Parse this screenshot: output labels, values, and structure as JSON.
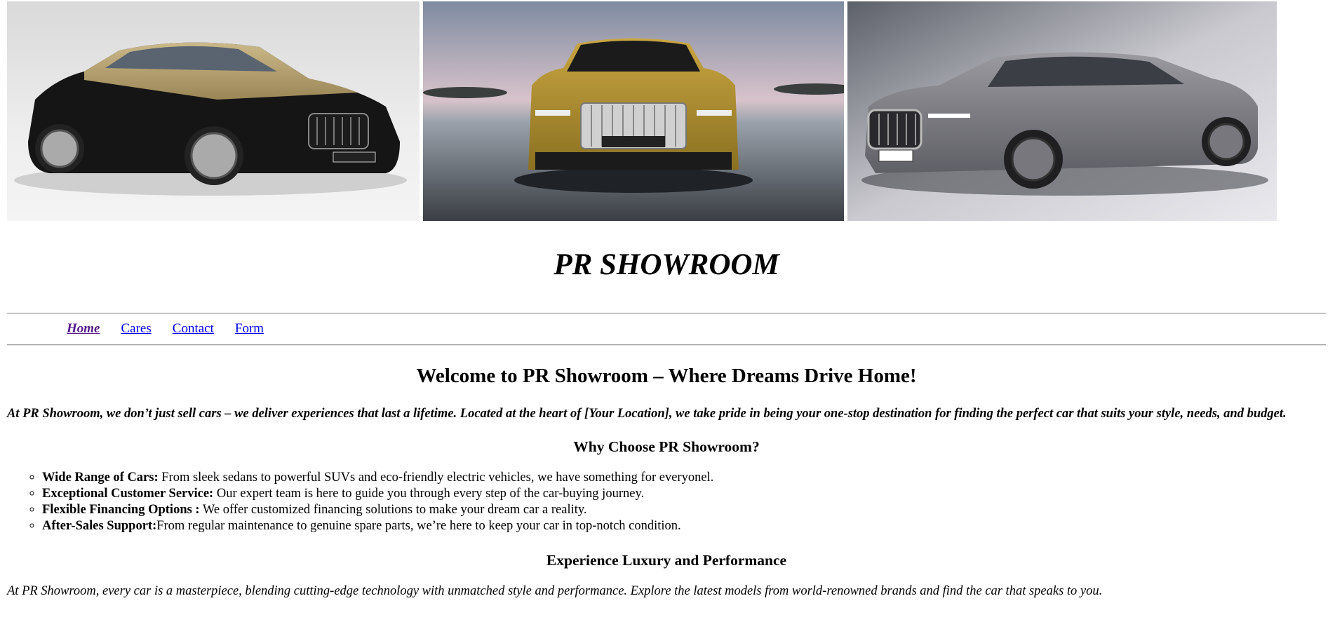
{
  "gallery": {
    "images": [
      {
        "alt": "Maybach sedan in gold and black",
        "icon": "car-photo"
      },
      {
        "alt": "Rolls-Royce Spectre front view",
        "icon": "car-photo"
      },
      {
        "alt": "BMW 7 series grey sedan",
        "icon": "car-photo"
      }
    ]
  },
  "site_title": "PR SHOWROOM",
  "nav": {
    "home": "Home",
    "cares": "Cares",
    "contact": "Contact",
    "form": "Form"
  },
  "main": {
    "welcome": "Welcome to PR Showroom – Where Dreams Drive Home!",
    "intro": "At PR Showroom, we don’t just sell cars – we deliver experiences that last a lifetime. Located at the heart of [Your Location], we take pride in being your one-stop destination for finding the perfect car that suits your style, needs, and budget.",
    "why_heading": "Why Choose PR Showroom?",
    "features": [
      {
        "title": "Wide Range of Cars:",
        "text": " From sleek sedans to powerful SUVs and eco-friendly electric vehicles, we have something for everyonel."
      },
      {
        "title": "Exceptional Customer Service:",
        "text": " Our expert team is here to guide you through every step of the car-buying journey."
      },
      {
        "title": "Flexible Financing Options :",
        "text": " We offer customized financing solutions to make your dream car a reality."
      },
      {
        "title": "After-Sales Support:",
        "text": "From regular maintenance to genuine spare parts, we’re here to keep your car in top-notch condition."
      }
    ],
    "experience_heading": "Experience Luxury and Performance",
    "outro": "At PR Showroom, every car is a masterpiece, blending cutting-edge technology with unmatched style and performance. Explore the latest models from world-renowned brands and find the car that speaks to you."
  },
  "colors": {
    "link": "#0000ee",
    "visited_link": "#551a8b"
  }
}
